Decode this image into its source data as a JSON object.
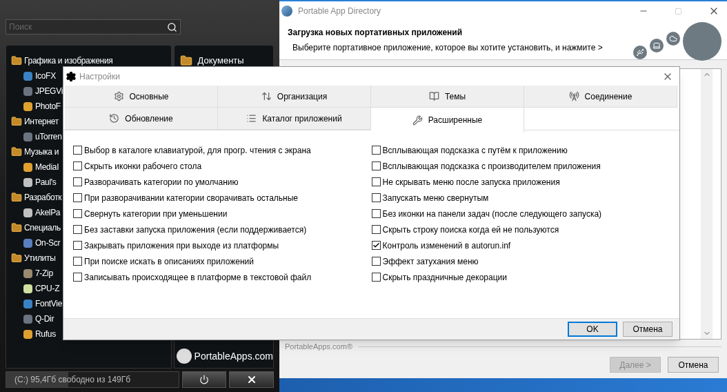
{
  "launcher": {
    "search": {
      "placeholder": "Поиск"
    },
    "tree": [
      {
        "label": "Графика и изображения",
        "children": [
          {
            "label": "IcoFX"
          },
          {
            "label": "JPEGVi"
          },
          {
            "label": "PhotoF"
          }
        ]
      },
      {
        "label": "Интернет",
        "children": [
          {
            "label": "uTorren"
          }
        ]
      },
      {
        "label": "Музыка и",
        "children": [
          {
            "label": "MediaI"
          },
          {
            "label": "Paul's"
          }
        ]
      },
      {
        "label": "Разработк",
        "children": [
          {
            "label": "AkelPa"
          }
        ]
      },
      {
        "label": "Специаль",
        "children": [
          {
            "label": "On-Scr"
          }
        ]
      },
      {
        "label": "Утилиты",
        "children": [
          {
            "label": "7-Zip"
          },
          {
            "label": "CPU-Z"
          },
          {
            "label": "FontVie"
          },
          {
            "label": "Q-Dir"
          },
          {
            "label": "Rufus"
          }
        ]
      }
    ],
    "side_items": [
      {
        "label": "Документы"
      }
    ],
    "brand": "PortableApps.com",
    "drive": {
      "text": "(C:) 95,4Гб свободно из 149Гб",
      "level": 0.36
    }
  },
  "directory": {
    "title": "Portable App Directory",
    "heading": "Загрузка новых портативных приложений",
    "subtitle": "Выберите портативное приложение, которое вы хотите установить, и нажмите >",
    "footer_brand": "PortableApps.com®",
    "buttons": [
      {
        "label": "Далее >",
        "disabled": true
      },
      {
        "label": "Отмена",
        "disabled": false
      }
    ]
  },
  "settings": {
    "title": "Настройки",
    "tabs": [
      [
        {
          "label": "Основные",
          "selected": false
        },
        {
          "label": "Организация",
          "selected": false
        },
        {
          "label": "Темы",
          "selected": false
        },
        {
          "label": "Соединение",
          "selected": false
        }
      ],
      [
        {
          "label": "Обновление",
          "selected": false
        },
        {
          "label": "Каталог приложений",
          "selected": false
        },
        {
          "label": "Расширенные",
          "selected": true
        }
      ]
    ],
    "columns": [
      [
        {
          "label": "Выбор в каталоге клавиатурой, для прогр. чтения с экрана",
          "checked": false
        },
        {
          "label": "Скрыть иконки рабочего стола",
          "checked": false
        },
        {
          "label": "Разворачивать категории по умолчанию",
          "checked": false
        },
        {
          "label": "При разворачивании категории сворачивать остальные",
          "checked": false
        },
        {
          "label": "Свернуть категории при уменьшении",
          "checked": false
        },
        {
          "label": "Без заставки запуска приложения (если поддерживается)",
          "checked": false
        },
        {
          "label": "Закрывать приложения при выходе из платформы",
          "checked": false
        },
        {
          "label": "При поиске искать в описаниях приложений",
          "checked": false
        },
        {
          "label": "Записывать происходящее в платформе в текстовой файл",
          "checked": false
        }
      ],
      [
        {
          "label": "Всплывающая подсказка с путём к приложению",
          "checked": false
        },
        {
          "label": "Всплывающая подсказка с производителем приложения",
          "checked": false
        },
        {
          "label": "Не скрывать меню после запуска приложения",
          "checked": false
        },
        {
          "label": "Запускать меню свернутым",
          "checked": false
        },
        {
          "label": "Без иконки на панели задач (после следующего запуска)",
          "checked": false
        },
        {
          "label": "Скрыть строку поиска когда ей не пользуются",
          "checked": false
        },
        {
          "label": "Контроль изменений в autorun.inf",
          "checked": true
        },
        {
          "label": "Эффект затухания меню",
          "checked": false
        },
        {
          "label": "Скрыть праздничные декорации",
          "checked": false
        }
      ]
    ],
    "buttons": [
      {
        "label": "OK",
        "default": true
      },
      {
        "label": "Отмена",
        "default": false
      }
    ]
  }
}
